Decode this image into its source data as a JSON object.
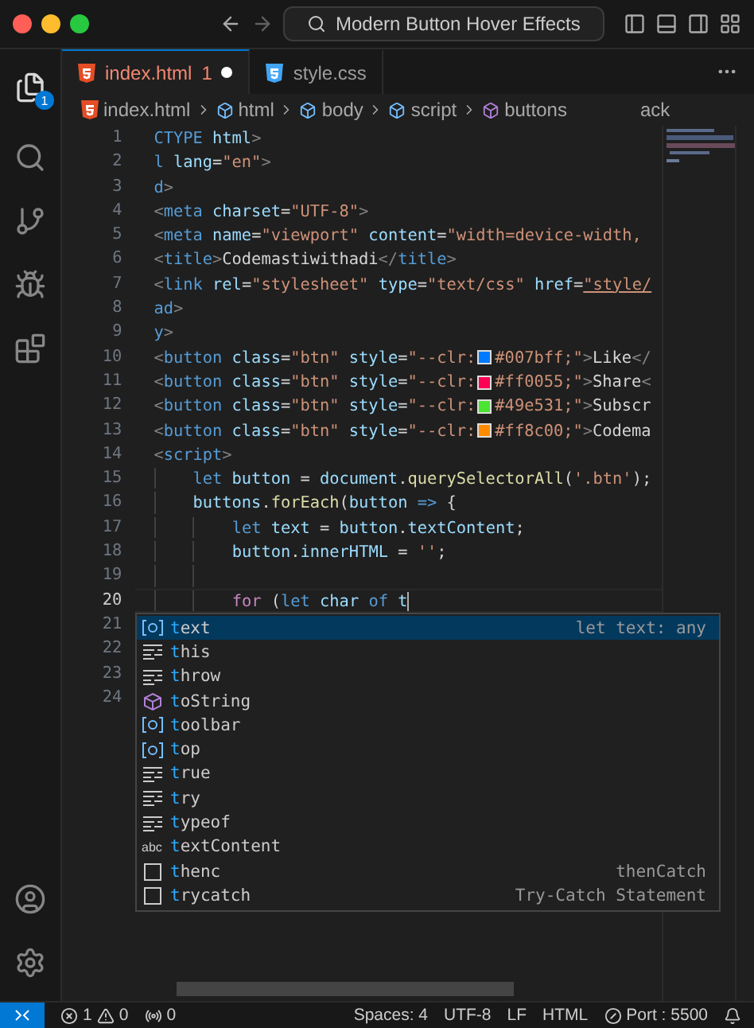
{
  "window": {
    "title": "Modern Button Hover Effects"
  },
  "activity_bar": {
    "explorer_badge": "1"
  },
  "tabs": [
    {
      "label": "index.html",
      "kind": "html",
      "problems": "1",
      "modified": true,
      "selected": true
    },
    {
      "label": "style.css",
      "kind": "css",
      "modified": false,
      "selected": false
    }
  ],
  "breadcrumbs": [
    {
      "label": "index.html",
      "kind": "html"
    },
    {
      "label": "html",
      "kind": "element"
    },
    {
      "label": "body",
      "kind": "element"
    },
    {
      "label": "script",
      "kind": "element"
    },
    {
      "label": "buttons",
      "kind": "variable"
    },
    {
      "label": "ack",
      "kind": "plain"
    }
  ],
  "editor": {
    "lines": [
      {
        "number": "1",
        "current": false,
        "tokens": [
          {
            "kind": "tag",
            "text": "CTYPE "
          },
          {
            "kind": "attr",
            "text": "html"
          },
          {
            "kind": "punct",
            "text": ">"
          }
        ]
      },
      {
        "number": "2",
        "current": false,
        "tokens": [
          {
            "kind": "tag",
            "text": "l"
          },
          {
            "kind": "attr",
            "text": " lang"
          },
          {
            "kind": "text",
            "text": "="
          },
          {
            "kind": "string",
            "text": "\"en\""
          },
          {
            "kind": "punct",
            "text": ">"
          }
        ]
      },
      {
        "number": "3",
        "current": false,
        "tokens": [
          {
            "kind": "tag",
            "text": "d"
          },
          {
            "kind": "punct",
            "text": ">"
          }
        ]
      },
      {
        "number": "4",
        "current": false,
        "tokens": [
          {
            "kind": "punct",
            "text": "<"
          },
          {
            "kind": "tag",
            "text": "meta"
          },
          {
            "kind": "attr",
            "text": " charset"
          },
          {
            "kind": "text",
            "text": "="
          },
          {
            "kind": "string",
            "text": "\"UTF-8\""
          },
          {
            "kind": "punct",
            "text": ">"
          }
        ]
      },
      {
        "number": "5",
        "current": false,
        "tokens": [
          {
            "kind": "punct",
            "text": "<"
          },
          {
            "kind": "tag",
            "text": "meta"
          },
          {
            "kind": "attr",
            "text": " name"
          },
          {
            "kind": "text",
            "text": "="
          },
          {
            "kind": "string",
            "text": "\"viewport\""
          },
          {
            "kind": "attr",
            "text": " content"
          },
          {
            "kind": "text",
            "text": "="
          },
          {
            "kind": "string",
            "text": "\"width=device-width,"
          }
        ]
      },
      {
        "number": "6",
        "current": false,
        "tokens": [
          {
            "kind": "punct",
            "text": "<"
          },
          {
            "kind": "tag",
            "text": "title"
          },
          {
            "kind": "punct",
            "text": ">"
          },
          {
            "kind": "text",
            "text": "Codemastiwithadi"
          },
          {
            "kind": "punct",
            "text": "</"
          },
          {
            "kind": "tag",
            "text": "title"
          },
          {
            "kind": "punct",
            "text": ">"
          }
        ]
      },
      {
        "number": "7",
        "current": false,
        "tokens": [
          {
            "kind": "punct",
            "text": "<"
          },
          {
            "kind": "tag",
            "text": "link"
          },
          {
            "kind": "attr",
            "text": " rel"
          },
          {
            "kind": "text",
            "text": "="
          },
          {
            "kind": "string",
            "text": "\"stylesheet\""
          },
          {
            "kind": "attr",
            "text": " type"
          },
          {
            "kind": "text",
            "text": "="
          },
          {
            "kind": "string",
            "text": "\"text/css\""
          },
          {
            "kind": "attr",
            "text": " href"
          },
          {
            "kind": "text",
            "text": "="
          },
          {
            "kind": "link",
            "text": "\"style/"
          }
        ]
      },
      {
        "number": "8",
        "current": false,
        "tokens": [
          {
            "kind": "tag",
            "text": "ad"
          },
          {
            "kind": "punct",
            "text": ">"
          }
        ]
      },
      {
        "number": "9",
        "current": false,
        "tokens": [
          {
            "kind": "tag",
            "text": "y"
          },
          {
            "kind": "punct",
            "text": ">"
          }
        ]
      },
      {
        "number": "10",
        "current": false,
        "tokens": [
          {
            "kind": "punct",
            "text": "<"
          },
          {
            "kind": "tag",
            "text": "button"
          },
          {
            "kind": "attr",
            "text": " class"
          },
          {
            "kind": "text",
            "text": "="
          },
          {
            "kind": "string",
            "text": "\"btn\""
          },
          {
            "kind": "attr",
            "text": " style"
          },
          {
            "kind": "text",
            "text": "="
          },
          {
            "kind": "string",
            "text": "\"--clr:"
          },
          {
            "kind": "swatch",
            "color": "#007bff"
          },
          {
            "kind": "string",
            "text": "#007bff;\""
          },
          {
            "kind": "punct",
            "text": ">"
          },
          {
            "kind": "text",
            "text": "Like"
          },
          {
            "kind": "punct",
            "text": "</"
          }
        ]
      },
      {
        "number": "11",
        "current": false,
        "tokens": [
          {
            "kind": "punct",
            "text": "<"
          },
          {
            "kind": "tag",
            "text": "button"
          },
          {
            "kind": "attr",
            "text": " class"
          },
          {
            "kind": "text",
            "text": "="
          },
          {
            "kind": "string",
            "text": "\"btn\""
          },
          {
            "kind": "attr",
            "text": " style"
          },
          {
            "kind": "text",
            "text": "="
          },
          {
            "kind": "string",
            "text": "\"--clr:"
          },
          {
            "kind": "swatch",
            "color": "#ff0055"
          },
          {
            "kind": "string",
            "text": "#ff0055;\""
          },
          {
            "kind": "punct",
            "text": ">"
          },
          {
            "kind": "text",
            "text": "Share"
          },
          {
            "kind": "punct",
            "text": "<"
          }
        ]
      },
      {
        "number": "12",
        "current": false,
        "tokens": [
          {
            "kind": "punct",
            "text": "<"
          },
          {
            "kind": "tag",
            "text": "button"
          },
          {
            "kind": "attr",
            "text": " class"
          },
          {
            "kind": "text",
            "text": "="
          },
          {
            "kind": "string",
            "text": "\"btn\""
          },
          {
            "kind": "attr",
            "text": " style"
          },
          {
            "kind": "text",
            "text": "="
          },
          {
            "kind": "string",
            "text": "\"--clr:"
          },
          {
            "kind": "swatch",
            "color": "#49e531"
          },
          {
            "kind": "string",
            "text": "#49e531;\""
          },
          {
            "kind": "punct",
            "text": ">"
          },
          {
            "kind": "text",
            "text": "Subscr"
          }
        ]
      },
      {
        "number": "13",
        "current": false,
        "tokens": [
          {
            "kind": "punct",
            "text": "<"
          },
          {
            "kind": "tag",
            "text": "button"
          },
          {
            "kind": "attr",
            "text": " class"
          },
          {
            "kind": "text",
            "text": "="
          },
          {
            "kind": "string",
            "text": "\"btn\""
          },
          {
            "kind": "attr",
            "text": " style"
          },
          {
            "kind": "text",
            "text": "="
          },
          {
            "kind": "string",
            "text": "\"--clr:"
          },
          {
            "kind": "swatch",
            "color": "#ff8c00"
          },
          {
            "kind": "string",
            "text": "#ff8c00;\""
          },
          {
            "kind": "punct",
            "text": ">"
          },
          {
            "kind": "text",
            "text": "Codema"
          }
        ]
      },
      {
        "number": "14",
        "current": false,
        "tokens": [
          {
            "kind": "punct",
            "text": "<"
          },
          {
            "kind": "tag",
            "text": "script"
          },
          {
            "kind": "punct",
            "text": ">"
          }
        ],
        "children": [
          {
            "number": "15",
            "current": false,
            "tokens": [
              {
                "kind": "keyword",
                "text": "let"
              },
              {
                "kind": "var",
                "text": " button"
              },
              {
                "kind": "text",
                "text": " = "
              },
              {
                "kind": "var",
                "text": "document"
              },
              {
                "kind": "text",
                "text": "."
              },
              {
                "kind": "func",
                "text": "querySelectorAll"
              },
              {
                "kind": "text",
                "text": "("
              },
              {
                "kind": "string",
                "text": "'.btn'"
              },
              {
                "kind": "text",
                "text": ");"
              }
            ]
          },
          {
            "number": "16",
            "current": false,
            "tokens": [
              {
                "kind": "var",
                "text": "buttons"
              },
              {
                "kind": "text",
                "text": "."
              },
              {
                "kind": "func",
                "text": "forEach"
              },
              {
                "kind": "text",
                "text": "("
              },
              {
                "kind": "var",
                "text": "button"
              },
              {
                "kind": "keyword",
                "text": " =>"
              },
              {
                "kind": "text",
                "text": " {"
              }
            ],
            "children": [
              {
                "number": "17",
                "current": false,
                "tokens": [
                  {
                    "kind": "keyword",
                    "text": "let"
                  },
                  {
                    "kind": "var",
                    "text": " text"
                  },
                  {
                    "kind": "text",
                    "text": " = "
                  },
                  {
                    "kind": "var",
                    "text": "button"
                  },
                  {
                    "kind": "text",
                    "text": "."
                  },
                  {
                    "kind": "var",
                    "text": "textContent"
                  },
                  {
                    "kind": "text",
                    "text": ";"
                  }
                ]
              },
              {
                "number": "18",
                "current": false,
                "tokens": [
                  {
                    "kind": "var",
                    "text": "button"
                  },
                  {
                    "kind": "text",
                    "text": "."
                  },
                  {
                    "kind": "var",
                    "text": "innerHTML"
                  },
                  {
                    "kind": "text",
                    "text": " = "
                  },
                  {
                    "kind": "string",
                    "text": "''"
                  },
                  {
                    "kind": "text",
                    "text": ";"
                  }
                ]
              },
              {
                "number": "19",
                "current": false
              },
              {
                "number": "20",
                "current": true,
                "tokens": [
                  {
                    "kind": "control",
                    "text": "for"
                  },
                  {
                    "kind": "text",
                    "text": " ("
                  },
                  {
                    "kind": "keyword",
                    "text": "let"
                  },
                  {
                    "kind": "var",
                    "text": " char"
                  },
                  {
                    "kind": "keyword",
                    "text": " of"
                  },
                  {
                    "kind": "var",
                    "text": " t"
                  }
                ]
              }
            ]
          }
        ]
      },
      {
        "number": "21",
        "current": false
      },
      {
        "number": "22",
        "current": false
      },
      {
        "number": "23",
        "current": false
      },
      {
        "number": "24",
        "current": false
      }
    ]
  },
  "suggestions": [
    {
      "label": "text",
      "kind": "variable",
      "detail": "let text: any",
      "selected": true
    },
    {
      "label": "this",
      "kind": "keyword",
      "selected": false
    },
    {
      "label": "throw",
      "kind": "keyword",
      "selected": false
    },
    {
      "label": "toString",
      "kind": "method",
      "selected": false
    },
    {
      "label": "toolbar",
      "kind": "variable",
      "selected": false
    },
    {
      "label": "top",
      "kind": "variable",
      "selected": false
    },
    {
      "label": "true",
      "kind": "keyword",
      "selected": false
    },
    {
      "label": "try",
      "kind": "keyword",
      "selected": false
    },
    {
      "label": "typeof",
      "kind": "keyword",
      "selected": false
    },
    {
      "label": "textContent",
      "kind": "word",
      "glyph": "abc",
      "selected": false
    },
    {
      "label": "thenc",
      "kind": "snippet",
      "detail": "thenCatch",
      "selected": false
    },
    {
      "label": "trycatch",
      "kind": "snippet",
      "detail": "Try-Catch Statement",
      "selected": false
    }
  ],
  "status_bar": {
    "errors": "1",
    "warnings": "0",
    "ports": "0",
    "indent": "Spaces: 4",
    "encoding": "UTF-8",
    "eol": "LF",
    "language": "HTML",
    "server": "Port : 5500"
  }
}
